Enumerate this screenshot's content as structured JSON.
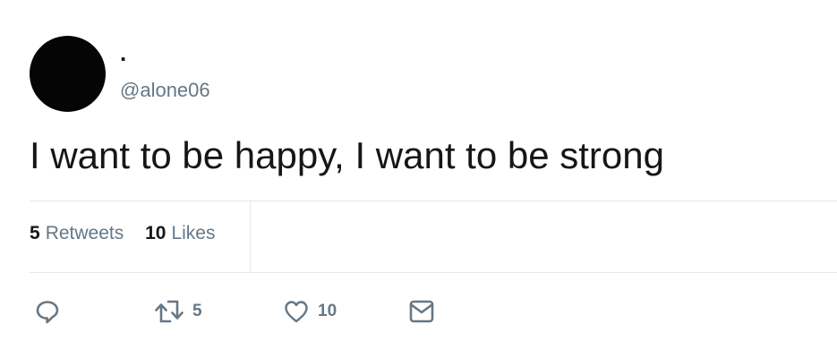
{
  "tweet": {
    "author": {
      "display_name": ".",
      "handle": "@alone06"
    },
    "text": "I want to be happy, I want to be strong",
    "stats": {
      "retweets_count": "5",
      "retweets_label": "Retweets",
      "likes_count": "10",
      "likes_label": "Likes"
    },
    "actions": {
      "retweet_count": "5",
      "like_count": "10"
    }
  },
  "colors": {
    "text_primary": "#14171a",
    "text_secondary": "#657786",
    "divider": "#e1e8ed",
    "avatar": "#050505"
  },
  "icons": {
    "reply": "reply-icon",
    "retweet": "retweet-icon",
    "like": "heart-icon",
    "direct_message": "envelope-icon"
  }
}
